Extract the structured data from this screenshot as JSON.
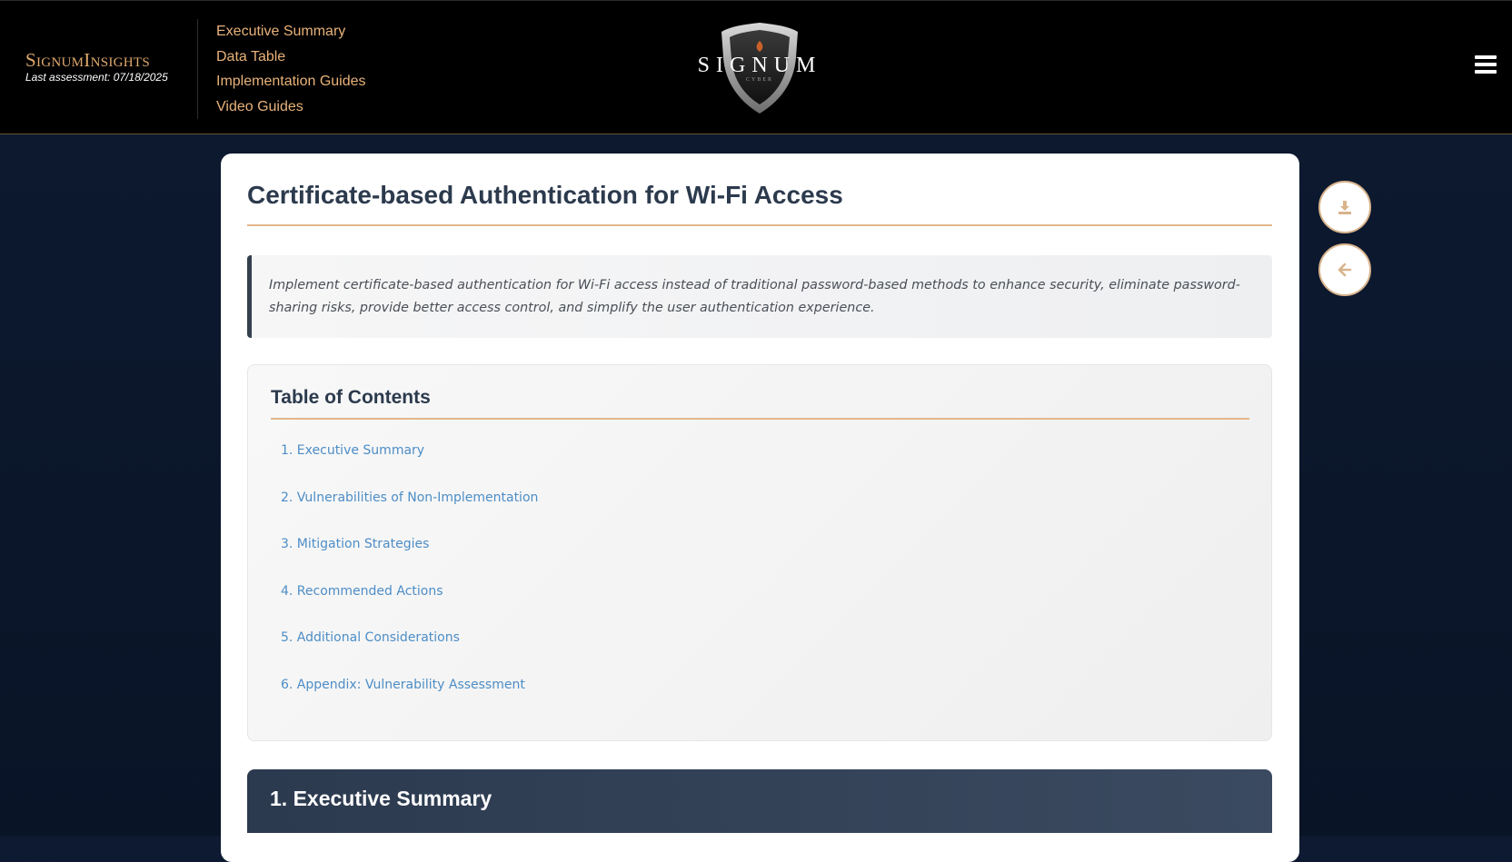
{
  "header": {
    "brand_name": "SignumInsights",
    "last_assessment": "Last assessment: 07/18/2025",
    "nav": [
      "Executive Summary",
      "Data Table",
      "Implementation Guides",
      "Video Guides"
    ],
    "logo_text": "SIGNUM",
    "logo_subtext": "CYBER",
    "menu_icon": "hamburger-icon"
  },
  "page": {
    "title": "Certificate-based Authentication for Wi-Fi Access",
    "intro": "Implement certificate-based authentication for Wi-Fi access instead of traditional password-based methods to enhance security, eliminate password-sharing risks, provide better access control, and simplify the user authentication experience.",
    "toc": {
      "title": "Table of Contents",
      "items": [
        "1. Executive Summary",
        "2. Vulnerabilities of Non-Implementation",
        "3. Mitigation Strategies",
        "4. Recommended Actions",
        "5. Additional Considerations",
        "6. Appendix: Vulnerability Assessment"
      ]
    },
    "section_1_title": "1. Executive Summary"
  },
  "actions": {
    "download_icon": "download-icon",
    "back_icon": "arrow-left-icon"
  },
  "colors": {
    "accent": "#e3b68a",
    "link": "#4d8dc6",
    "header_bg": "#000000",
    "page_bg": "#0d1a31",
    "heading": "#2c3a4d"
  }
}
